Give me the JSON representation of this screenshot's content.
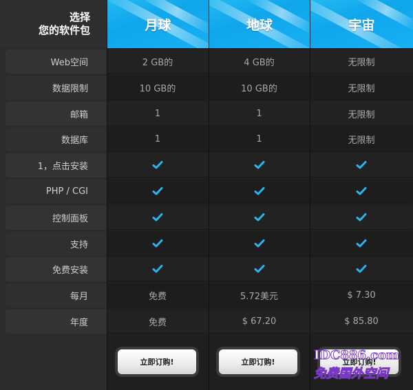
{
  "header": {
    "corner_line1": "选择",
    "corner_line2": "您的软件包",
    "plans": [
      "月球",
      "地球",
      "宇宙"
    ]
  },
  "rows": [
    {
      "label": "Web空间",
      "values": [
        "2 GB的",
        "4 GB的",
        "无限制"
      ]
    },
    {
      "label": "数据限制",
      "values": [
        "10 GB的",
        "10 GB的",
        "无限制"
      ]
    },
    {
      "label": "邮箱",
      "values": [
        "1",
        "1",
        "无限制"
      ]
    },
    {
      "label": "数据库",
      "values": [
        "1",
        "1",
        "无限制"
      ]
    },
    {
      "label": "1，点击安装",
      "values": [
        "check",
        "check",
        "check"
      ]
    },
    {
      "label": "PHP / CGI",
      "values": [
        "check",
        "check",
        "check"
      ]
    },
    {
      "label": "控制面板",
      "values": [
        "check",
        "check",
        "check"
      ]
    },
    {
      "label": "支持",
      "values": [
        "check",
        "check",
        "check"
      ]
    },
    {
      "label": "免费安装",
      "values": [
        "check",
        "check",
        "check"
      ]
    },
    {
      "label": "每月",
      "values": [
        "免费",
        "5.72美元",
        "$ 7.30"
      ]
    },
    {
      "label": "年度",
      "values": [
        "免费",
        "$ 67.20",
        "$ 85.80"
      ]
    }
  ],
  "order_button_label": "立即订购!",
  "watermark": {
    "line1": "IDC886.com",
    "line2": "免费国外空间"
  },
  "colors": {
    "accent": "#1aaff0",
    "check": "#29b6f0"
  },
  "icons": {
    "check": "check-icon"
  }
}
